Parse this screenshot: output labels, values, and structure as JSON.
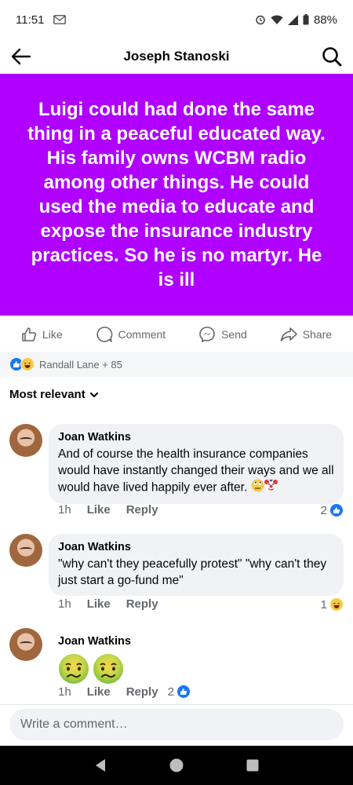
{
  "status_bar": {
    "time": "11:51",
    "battery": "88%"
  },
  "header": {
    "title": "Joseph Stanoski"
  },
  "post": {
    "text": "Luigi could had done the same thing in a peaceful educated way. His family owns WCBM radio among other things. He could used the media to educate and expose the insurance industry practices. So he is no martyr. He is ill",
    "background_color": "#b000ff"
  },
  "actions": {
    "like": "Like",
    "comment": "Comment",
    "send": "Send",
    "share": "Share"
  },
  "reactions": {
    "summary": "Randall Lane + 85"
  },
  "sort": {
    "label": "Most relevant"
  },
  "comments": [
    {
      "author": "Joan Watkins",
      "text": "And of course the health insurance companies would have instantly changed their ways and we all would have lived happily ever after.",
      "time": "1h",
      "like": "Like",
      "reply": "Reply",
      "reaction_count": "2"
    },
    {
      "author": "Joan Watkins",
      "text": "\"why can't they peacefully protest\" \"why can't they just start a go-fund me\"",
      "time": "1h",
      "like": "Like",
      "reply": "Reply",
      "reaction_count": "1"
    },
    {
      "author": "Joan Watkins",
      "text": "",
      "time": "1h",
      "like": "Like",
      "reply": "Reply",
      "reaction_count": "2"
    }
  ],
  "composer": {
    "placeholder": "Write a comment…"
  },
  "colors": {
    "accent": "#1877f2",
    "post_bg": "#b000ff"
  }
}
